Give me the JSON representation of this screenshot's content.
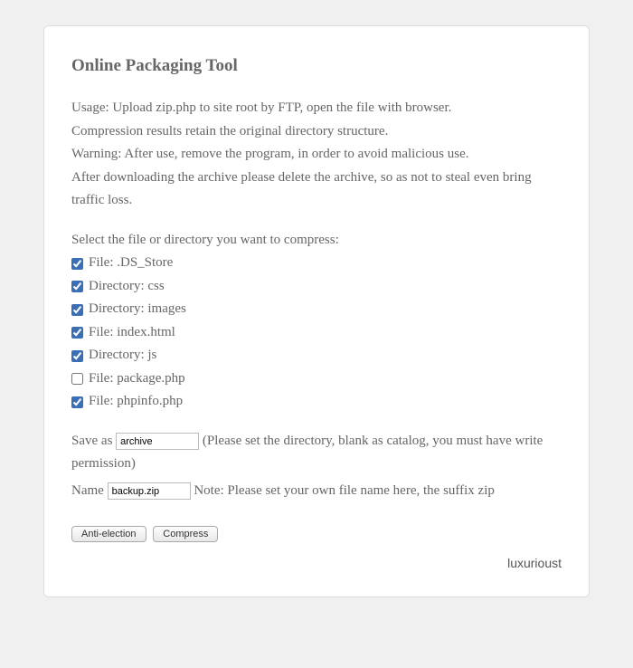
{
  "title": "Online Packaging Tool",
  "description": {
    "line1": "Usage: Upload zip.php to site root by FTP, open the file with browser.",
    "line2": "Compression results retain the original directory structure.",
    "line3": "Warning: After use, remove the program, in order to avoid malicious use.",
    "line4": "After downloading the archive please delete the archive, so as not to steal even bring traffic loss."
  },
  "select_label": "Select the file or directory you want to compress:",
  "files": [
    {
      "label": "File: .DS_Store",
      "checked": true
    },
    {
      "label": "Directory: css",
      "checked": true
    },
    {
      "label": "Directory: images",
      "checked": true
    },
    {
      "label": "File: index.html",
      "checked": true
    },
    {
      "label": "Directory: js",
      "checked": true
    },
    {
      "label": "File: package.php",
      "checked": false
    },
    {
      "label": "File: phpinfo.php",
      "checked": true
    }
  ],
  "save_as": {
    "label": "Save as",
    "value": "archive",
    "hint": "(Please set the directory, blank as catalog, you must have write permission)"
  },
  "name": {
    "label": "Name",
    "value": "backup.zip",
    "hint": "Note: Please set your own file name here, the suffix zip"
  },
  "buttons": {
    "anti_election": "Anti-election",
    "compress": "Compress"
  },
  "footer": "luxurioust"
}
